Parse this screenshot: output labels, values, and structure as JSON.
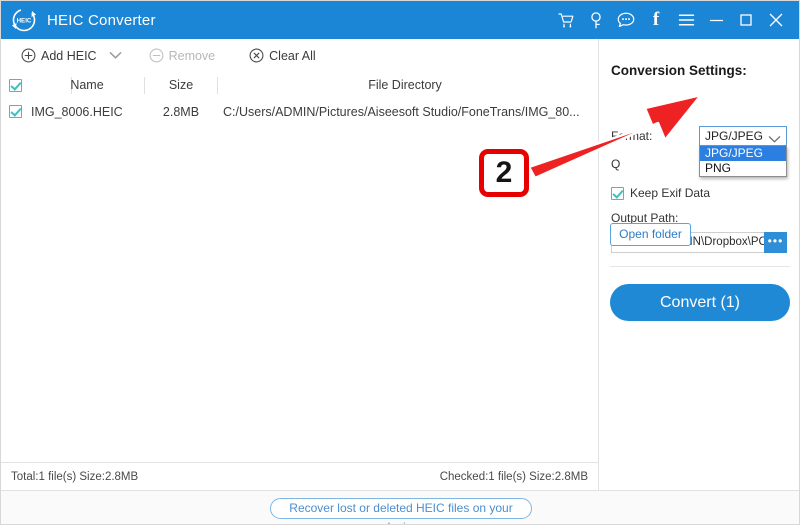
{
  "window": {
    "title": "HEIC Converter",
    "logo_icon": "heic-circular-logo",
    "controls": [
      {
        "name": "cart-icon",
        "label": "Cart"
      },
      {
        "name": "key-icon",
        "label": "Register"
      },
      {
        "name": "chat-icon",
        "label": "Feedback"
      },
      {
        "name": "facebook-icon",
        "label": "f"
      },
      {
        "name": "menu-icon",
        "label": "Menu"
      },
      {
        "name": "minimize-icon",
        "label": "Minimize"
      },
      {
        "name": "maximize-icon",
        "label": "Maximize"
      },
      {
        "name": "close-icon",
        "label": "Close"
      }
    ]
  },
  "toolbar": {
    "add_label": "Add HEIC",
    "add_caret": "⌄",
    "remove_label": "Remove",
    "clear_label": "Clear All"
  },
  "file_list": {
    "header_checkbox_checked": true,
    "columns": [
      "Name",
      "Size",
      "File Directory"
    ],
    "rows": [
      {
        "checked": true,
        "name": "IMG_8006.HEIC",
        "size": "2.8MB",
        "directory": "C:/Users/ADMIN/Pictures/Aiseesoft Studio/FoneTrans/IMG_80..."
      }
    ]
  },
  "status": {
    "left": "Total:1 file(s) Size:2.8MB",
    "right": "Checked:1 file(s) Size:2.8MB"
  },
  "settings": {
    "title": "Conversion Settings:",
    "format_label": "Format:",
    "format_value": "JPG/JPEG",
    "format_options": [
      "JPG/JPEG",
      "PNG"
    ],
    "format_selected_index": 0,
    "quality_label": "Q",
    "keep_exif_label": "Keep Exif Data",
    "keep_exif_checked": true,
    "output_path_label": "Output Path:",
    "output_path_value": "C:\\Users\\ADMIN\\Dropbox\\PC\\",
    "browse_label": "•••",
    "open_folder_label": "Open folder",
    "convert_label": "Convert (1)"
  },
  "footer": {
    "recover_label": "Recover lost or deleted HEIC files on your device"
  },
  "annotation": {
    "step_number": "2"
  },
  "colors": {
    "titlebar": "#1b85d6",
    "accent": "#2089d6",
    "checkbox": "#3fbfbf",
    "annotation_red": "#e60000",
    "dropdown_highlight": "#2a7fe0"
  }
}
